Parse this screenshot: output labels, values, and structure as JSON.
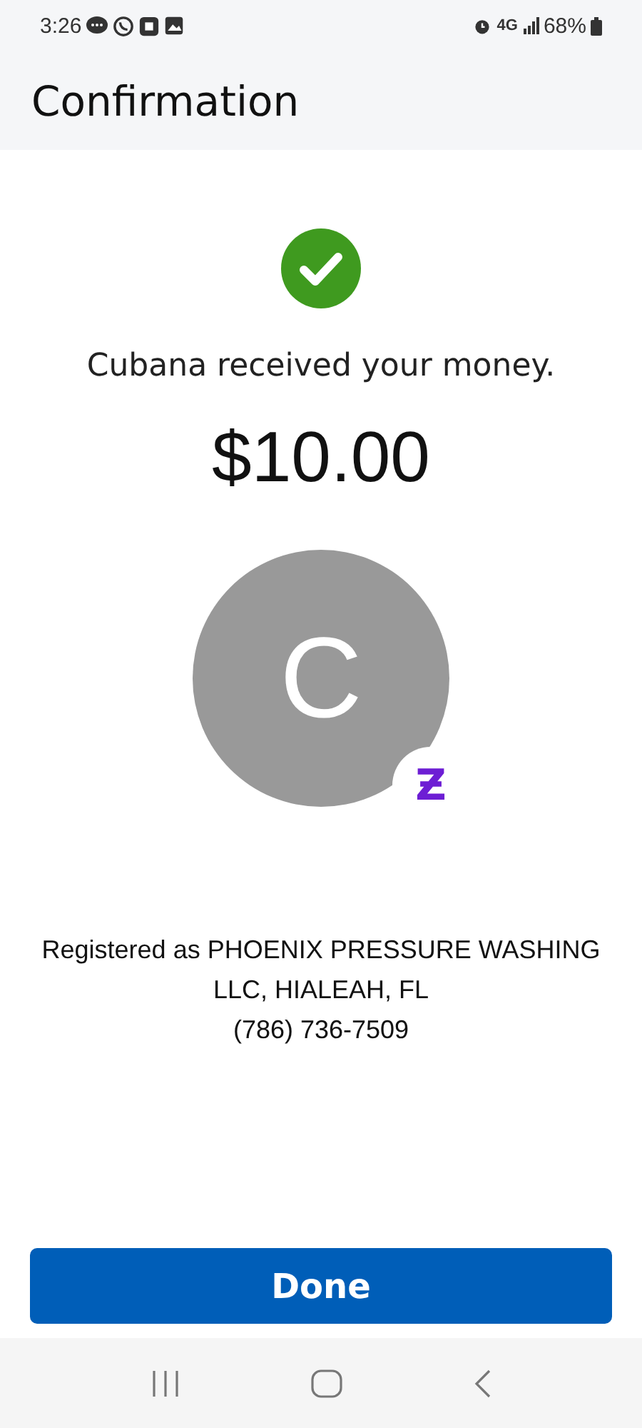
{
  "status_bar": {
    "time": "3:26",
    "network": "4G",
    "battery": "68%"
  },
  "header": {
    "title": "Confirmation"
  },
  "confirmation": {
    "message": "Cubana received your money.",
    "amount": "$10.00",
    "avatar_initial": "C",
    "badge": "Ƶ",
    "registration": "Registered as PHOENIX PRESSURE WASHING LLC, HIALEAH, FL",
    "phone": "(786) 736-7509"
  },
  "buttons": [
    {
      "label": "Done",
      "kind": "primary"
    }
  ]
}
